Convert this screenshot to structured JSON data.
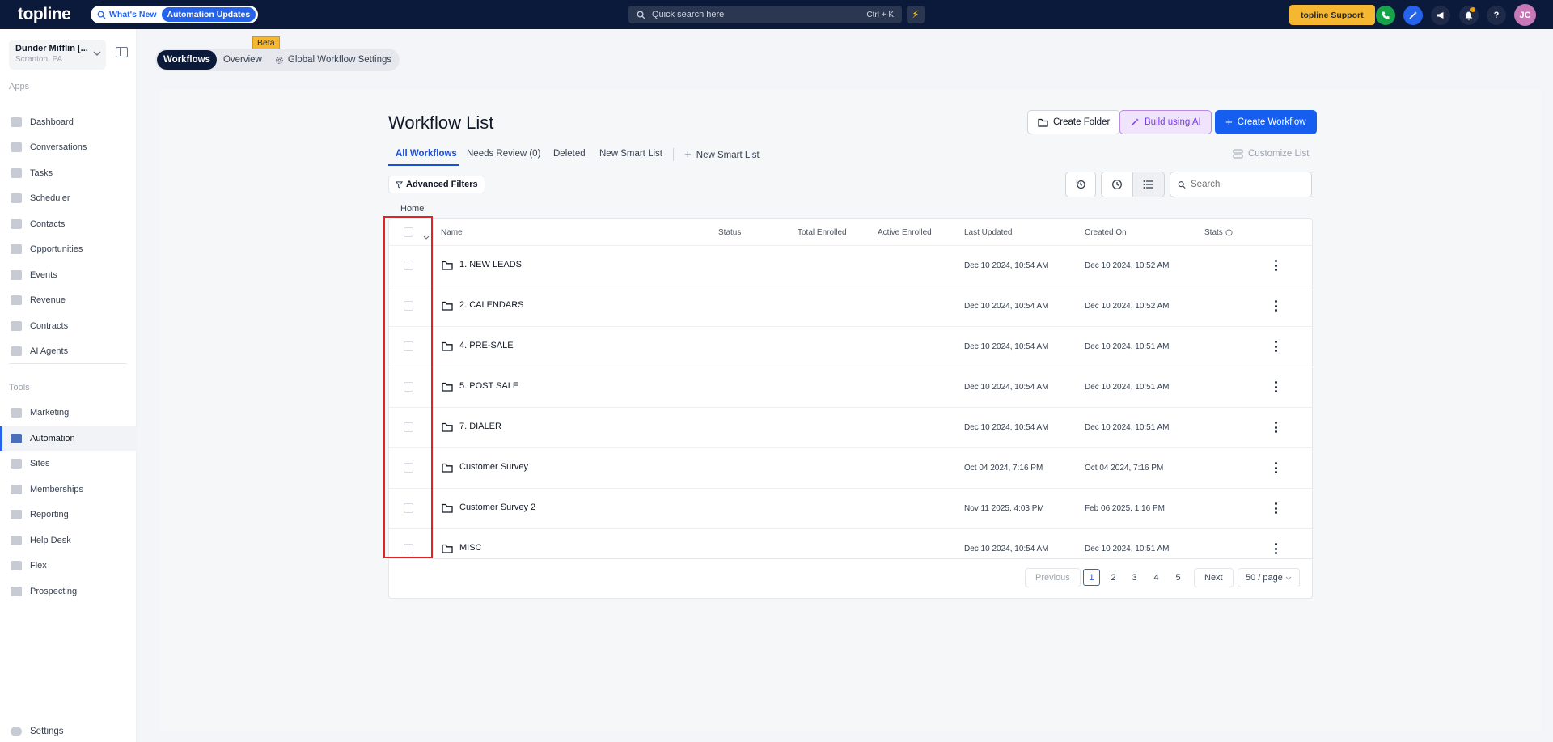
{
  "topbar": {
    "logo": "topline",
    "whats_new": "What's New",
    "automation_updates": "Automation Updates",
    "quick_search_placeholder": "Quick search here",
    "quick_search_shortcut": "Ctrl + K",
    "support_label": "topline Support",
    "avatar_initials": "JC"
  },
  "location": {
    "name": "Dunder Mifflin [...",
    "sub": "Scranton, PA"
  },
  "sidebar": {
    "apps_label": "Apps",
    "tools_label": "Tools",
    "apps": [
      {
        "label": "Dashboard"
      },
      {
        "label": "Conversations"
      },
      {
        "label": "Tasks"
      },
      {
        "label": "Scheduler"
      },
      {
        "label": "Contacts"
      },
      {
        "label": "Opportunities"
      },
      {
        "label": "Events"
      },
      {
        "label": "Revenue"
      },
      {
        "label": "Contracts"
      },
      {
        "label": "AI Agents"
      }
    ],
    "tools": [
      {
        "label": "Marketing"
      },
      {
        "label": "Automation",
        "active": true
      },
      {
        "label": "Sites"
      },
      {
        "label": "Memberships"
      },
      {
        "label": "Reporting"
      },
      {
        "label": "Help Desk"
      },
      {
        "label": "Flex"
      },
      {
        "label": "Prospecting"
      }
    ],
    "settings_label": "Settings"
  },
  "tabswitch": {
    "workflows": "Workflows",
    "overview": "Overview",
    "global_settings": "Global Workflow Settings",
    "beta": "Beta"
  },
  "page": {
    "title": "Workflow List",
    "create_folder": "Create Folder",
    "build_ai": "Build using AI",
    "create_workflow": "Create Workflow",
    "tabs": [
      "All Workflows",
      "Needs Review (0)",
      "Deleted",
      "New Smart List"
    ],
    "new_smart_list": "New Smart List",
    "customize_list": "Customize List",
    "advanced_filters": "Advanced Filters",
    "search_placeholder": "Search",
    "breadcrumb_home": "Home"
  },
  "table": {
    "columns": [
      "Name",
      "Status",
      "Total Enrolled",
      "Active Enrolled",
      "Last Updated",
      "Created On",
      "Stats"
    ],
    "rows": [
      {
        "name": "1. NEW LEADS",
        "last_updated": "Dec 10 2024, 10:54 AM",
        "created_on": "Dec 10 2024, 10:52 AM"
      },
      {
        "name": "2. CALENDARS",
        "last_updated": "Dec 10 2024, 10:54 AM",
        "created_on": "Dec 10 2024, 10:52 AM"
      },
      {
        "name": "4. PRE-SALE",
        "last_updated": "Dec 10 2024, 10:54 AM",
        "created_on": "Dec 10 2024, 10:51 AM"
      },
      {
        "name": "5. POST SALE",
        "last_updated": "Dec 10 2024, 10:54 AM",
        "created_on": "Dec 10 2024, 10:51 AM"
      },
      {
        "name": "7. DIALER",
        "last_updated": "Dec 10 2024, 10:54 AM",
        "created_on": "Dec 10 2024, 10:51 AM"
      },
      {
        "name": "Customer Survey",
        "last_updated": "Oct 04 2024, 7:16 PM",
        "created_on": "Oct 04 2024, 7:16 PM"
      },
      {
        "name": "Customer Survey 2",
        "last_updated": "Nov 11 2025, 4:03 PM",
        "created_on": "Feb 06 2025, 1:16 PM"
      },
      {
        "name": "MISC",
        "last_updated": "Dec 10 2024, 10:54 AM",
        "created_on": "Dec 10 2024, 10:51 AM"
      }
    ]
  },
  "pagination": {
    "previous": "Previous",
    "pages": [
      "1",
      "2",
      "3",
      "4",
      "5"
    ],
    "current": "1",
    "next": "Next",
    "per_page": "50 / page"
  },
  "colors": {
    "topbar": "#0b1a3a",
    "accent": "#155eef",
    "support": "#f5b731",
    "highlight_box": "#e02424"
  }
}
